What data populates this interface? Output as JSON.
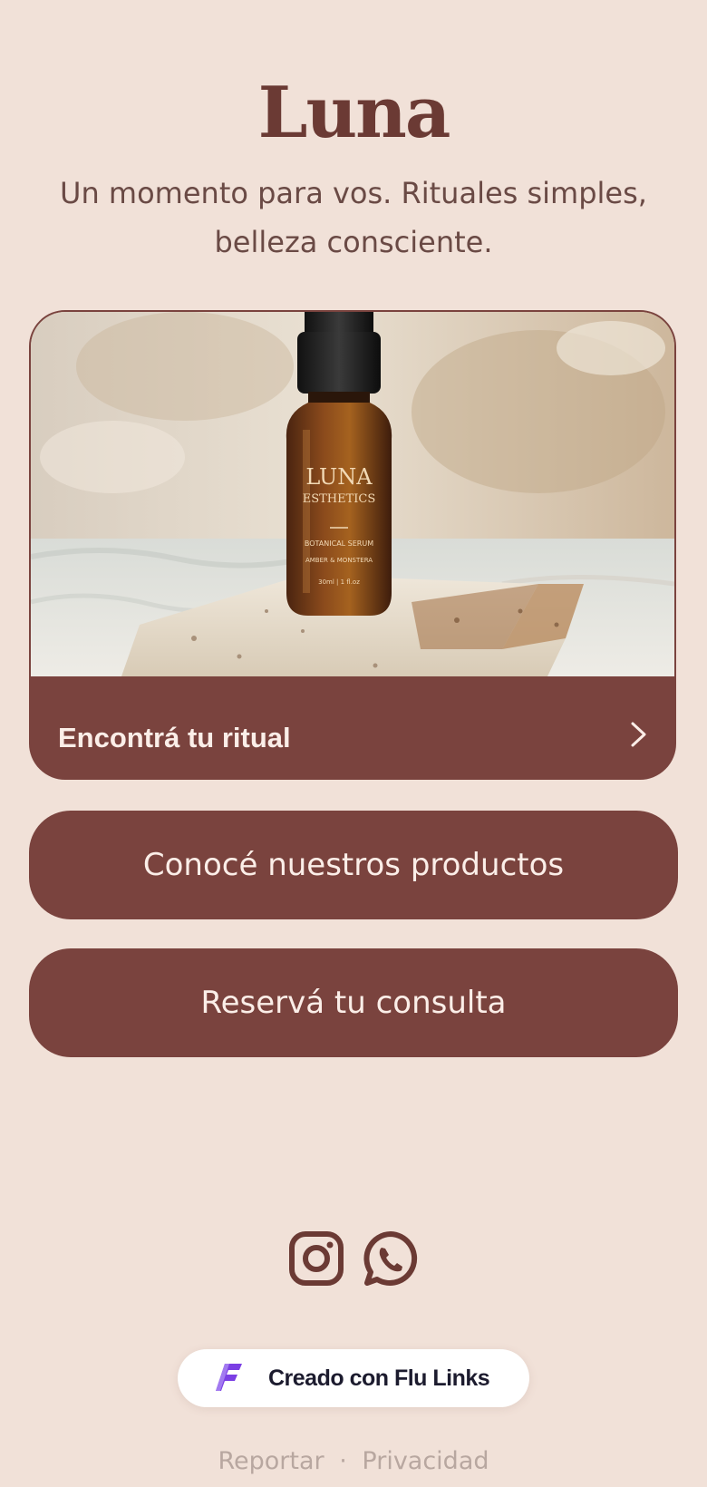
{
  "profile": {
    "title": "Luna",
    "subtitle": "Un momento para vos. Rituales simples, belleza consciente."
  },
  "feature_card": {
    "label": "Encontrá tu ritual",
    "image": {
      "brand_line1": "LUNA",
      "brand_line2": "ESTHETICS",
      "product_line1": "BOTANICAL SERUM",
      "product_line2": "AMBER & MONSTERA",
      "volume": "30ml | 1 fl.oz"
    }
  },
  "links": [
    {
      "label": "Conocé nuestros productos"
    },
    {
      "label": "Reservá tu consulta"
    }
  ],
  "socials": [
    {
      "name": "instagram-icon"
    },
    {
      "name": "whatsapp-icon"
    }
  ],
  "badge": {
    "label": "Creado con Flu Links"
  },
  "footer": {
    "report": "Reportar",
    "separator": "·",
    "privacy": "Privacidad"
  },
  "colors": {
    "background": "#f1e1d8",
    "accent": "#7a433e",
    "title": "#6b3a34",
    "button_text": "#fbeee8",
    "flu_purple": "#7b3fe4"
  }
}
